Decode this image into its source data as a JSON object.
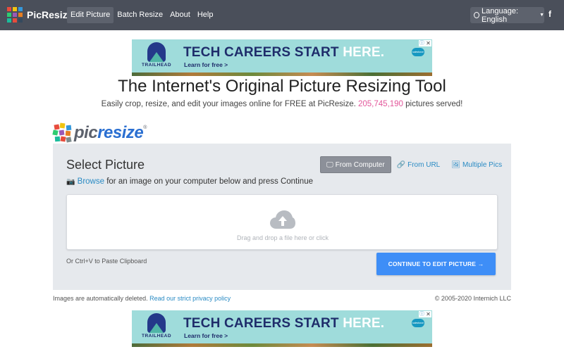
{
  "navbar": {
    "brand": "PicResize",
    "links": [
      {
        "label": "Edit Picture",
        "active": true
      },
      {
        "label": "Batch Resize",
        "active": false
      },
      {
        "label": "About",
        "active": false
      },
      {
        "label": "Help",
        "active": false
      }
    ],
    "language_label": "Language: English",
    "facebook_icon": "f"
  },
  "ad": {
    "logo_text": "TRAILHEAD",
    "headline_main": "TECH CAREERS START ",
    "headline_accent": "HERE.",
    "cta": "Learn for free >",
    "badge": "salesforce"
  },
  "main": {
    "title": "The Internet's Original Picture Resizing Tool",
    "subtitle_before": "Easily crop, resize, and edit your images online for FREE at PicResize. ",
    "pictures_served": "205,745,190",
    "subtitle_after": " pictures served!"
  },
  "logo": {
    "part1": "pic",
    "part2": "resize",
    "reg": "®"
  },
  "card": {
    "title": "Select Picture",
    "source_tabs": [
      {
        "label": "From Computer",
        "icon": "monitor-icon",
        "active": true
      },
      {
        "label": "From URL",
        "icon": "link-icon",
        "active": false
      },
      {
        "label": "Multiple Pics",
        "icon": "images-icon",
        "active": false
      }
    ],
    "browse_link": "Browse",
    "browse_rest": " for an image on your computer below and press Continue",
    "drop_text": "Drag and drop a file here or click",
    "paste_text": "Or Ctrl+V to Paste Clipboard",
    "continue_label": "CONTINUE TO EDIT PICTURE →"
  },
  "footer": {
    "deleted_text": "Images are automatically deleted. ",
    "privacy_link": "Read our strict privacy policy",
    "copyright": "© 2005-2020 Internich LLC"
  },
  "colors": {
    "navbar": "#4a4f5a",
    "accent_blue": "#3e8ef7",
    "link_blue": "#2a8bc4",
    "count_pink": "#e3579b",
    "card_bg": "#e6e9ed"
  }
}
